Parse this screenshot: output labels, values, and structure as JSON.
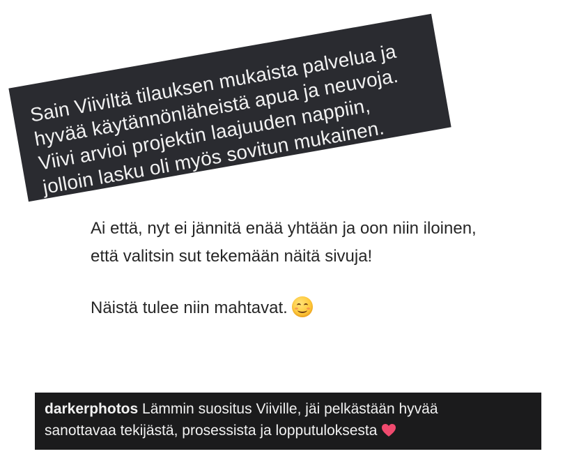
{
  "dark_card": {
    "lines": [
      "Sain Viiviltä tilauksen mukaista palvelua ja",
      "hyvää käytännönläheistä apua ja neuvoja.",
      "Viivi arvioi projektin laajuuden nappiin,",
      "jolloin lasku oli myös sovitun mukainen."
    ],
    "background": "#2a2b30",
    "text_color": "#f2f2f2"
  },
  "chat": {
    "lines": [
      "Ai että, nyt ei jännitä enää yhtään ja oon niin iloinen,",
      "että valitsin sut tekemään näitä sivuja!",
      "Näistä tulee niin mahtavat."
    ],
    "emoji": "smiling-face-icon",
    "text_color": "#262626"
  },
  "comment": {
    "username": "darkerphotos",
    "line1_text": "Lämmin suositus Viiville, jäi pelkästään hyvää",
    "line2_text": "sanottavaa tekijästä, prosessista ja lopputuloksesta",
    "emoji": "heart-icon",
    "background": "#1b1b1c",
    "heart_color": "#f04a6e"
  }
}
